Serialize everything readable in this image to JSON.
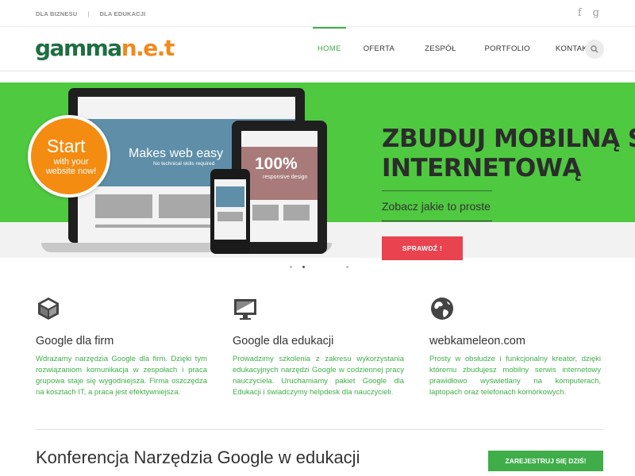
{
  "topbar": {
    "link1": "DLA BIZNESU",
    "separator": "|",
    "link2": "DLA EDUKACJI",
    "social": [
      {
        "icon": "facebook-icon",
        "glyph": "f"
      },
      {
        "icon": "google-plus-icon",
        "glyph": "g"
      }
    ]
  },
  "header": {
    "logo_main": "gamma",
    "logo_accent": "n.e.t",
    "nav": [
      {
        "label": "HOME",
        "active": true
      },
      {
        "label": "OFERTA",
        "active": false
      },
      {
        "label": "ZESPÓŁ",
        "active": false
      },
      {
        "label": "PORTFOLIO",
        "active": false
      },
      {
        "label": "KONTAKT",
        "active": false
      }
    ],
    "search_icon": "search-icon"
  },
  "hero": {
    "title_line1": "ZBUDUJ MOBILNĄ STRONĘ",
    "title_line2": "INTERNETOWĄ",
    "subtitle": "Zobacz jakie to proste",
    "cta": "SPRAWDŹ !",
    "badge_big": "Start",
    "badge_small": "with your website now!",
    "laptop_text": "Makes web easy",
    "laptop_subtext": "No technical skills required",
    "tablet_text": "100%",
    "tablet_subtext": "responsive design",
    "colors": {
      "green": "#4fc940",
      "orange": "#f48c12",
      "red": "#e8434f"
    }
  },
  "features": [
    {
      "icon": "cube-icon",
      "title": "Google dla firm",
      "text": "Wdrażamy narzędzia Google dla firm. Dzięki tym rozwiązaniom komunikacja w zespołach i praca grupowa staje się wygodniejsza. Firma oszczędza na kosztach IT, a praca jest efektywniejsza."
    },
    {
      "icon": "monitor-icon",
      "title": "Google dla edukacji",
      "text": "Prowadzimy szkolenia z zakresu wykorzystania edukacyjnych narzędzi Google w codziennej pracy nauczyciela. Uruchamiamy pakiet Google dla Edukacji i świadczymy helpdesk dla nauczycieli."
    },
    {
      "icon": "globe-icon",
      "title": "webkameleon.com",
      "text": "Prosty w obsłudze i funkcjonalny kreator, dzięki któremu zbudujesz mobilny serwis internetowy prawidłowo wyświetlany na komputerach, laptopach oraz telefonach komórkowych."
    }
  ],
  "bottom": {
    "title": "Konferencja Narzędzia Google w edukacji",
    "button": "ZAREJESTRUJ SIĘ DZIŚ!"
  }
}
